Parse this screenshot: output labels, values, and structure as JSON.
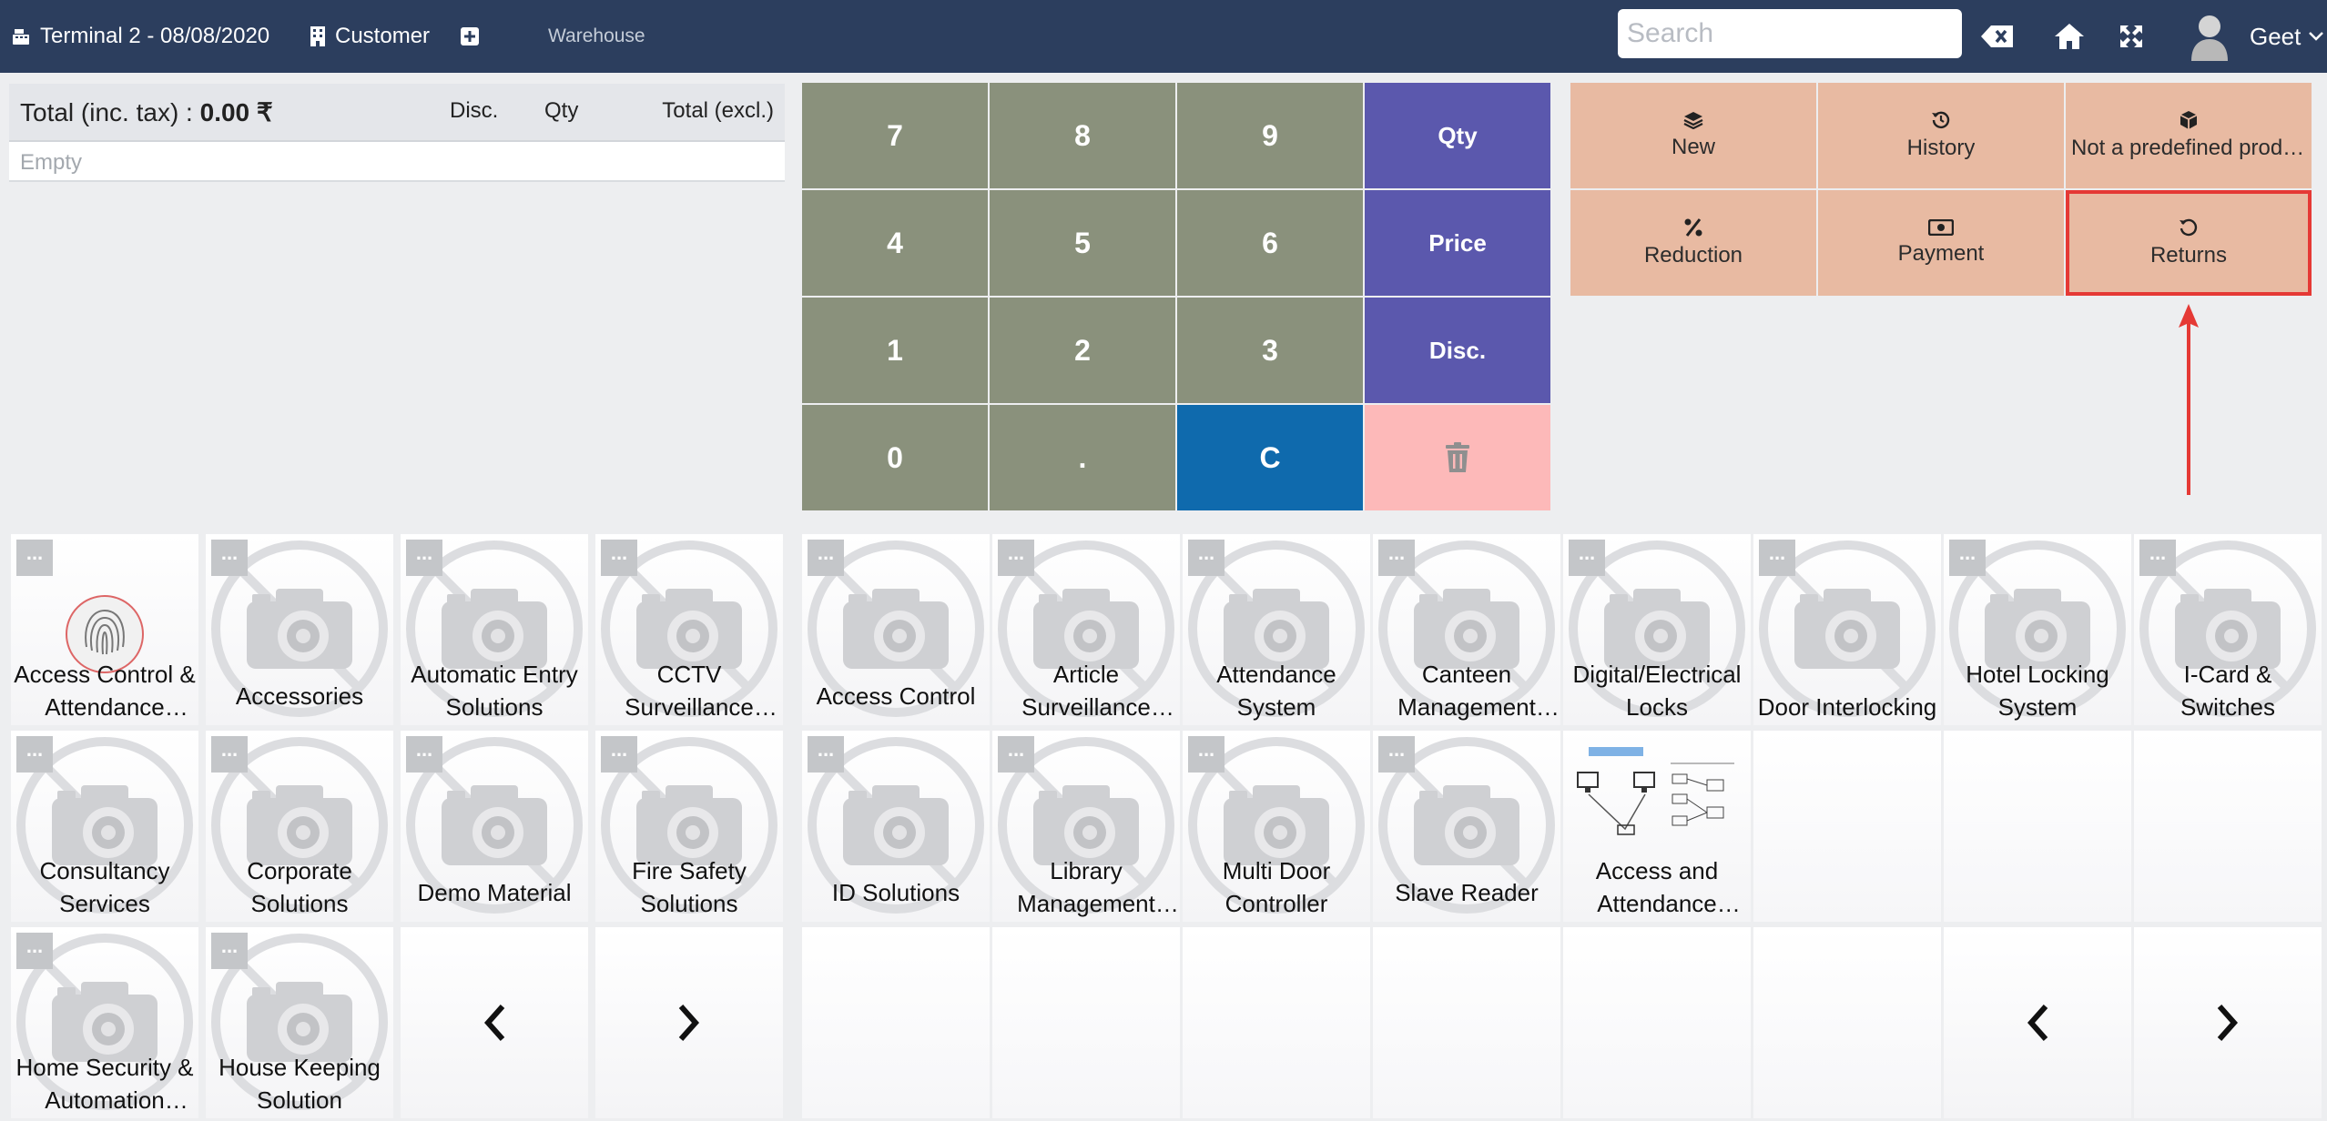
{
  "topbar": {
    "terminal": "Terminal 2 - 08/08/2020",
    "customer": "Customer",
    "warehouse": "Warehouse",
    "search_placeholder": "Search",
    "user": "Geet",
    "bg_color": "#2c3e5e"
  },
  "order": {
    "total_label": "Total (inc. tax) : ",
    "total_value": "0.00 ₹",
    "col_disc": "Disc.",
    "col_qty": "Qty",
    "col_total": "Total (excl.)",
    "empty_text": "Empty"
  },
  "numpad": {
    "keys": [
      "7",
      "8",
      "9",
      "Qty",
      "4",
      "5",
      "6",
      "Price",
      "1",
      "2",
      "3",
      "Disc.",
      "0",
      ".",
      "C"
    ],
    "trash_icon": "trash-icon"
  },
  "actions": {
    "new": "New",
    "history": "History",
    "not_predefined": "Not a predefined product",
    "reduction": "Reduction",
    "payment": "Payment",
    "returns": "Returns"
  },
  "categories": {
    "more": "...",
    "items": [
      "Access Control & Attendance Systems",
      "Accessories",
      "Automatic Entry Solutions",
      "CCTV Surveillance Systems",
      "Consultancy Services",
      "Corporate Solutions",
      "Demo Material",
      "Fire Safety Solutions",
      "Home Security & Automation Systems",
      "House Keeping Solution"
    ]
  },
  "products": {
    "items": [
      "Access Control",
      "Article Surveillance Systems",
      "Attendance System",
      "Canteen Management System",
      "Digital/Electrical Locks",
      "Door Interlocking",
      "Hotel Locking System",
      "I-Card & Switches",
      "ID Solutions",
      "Library Management System",
      "Multi Door Controller",
      "Slave Reader",
      "Access and Attendance Diagram"
    ]
  },
  "colors": {
    "numpad_key": "#8a917c",
    "numpad_op": "#5b58ad",
    "clear_key": "#0f6aad",
    "delete_key": "#fdb9b9",
    "action_button": "#e8baa2",
    "highlight": "#e53935"
  }
}
